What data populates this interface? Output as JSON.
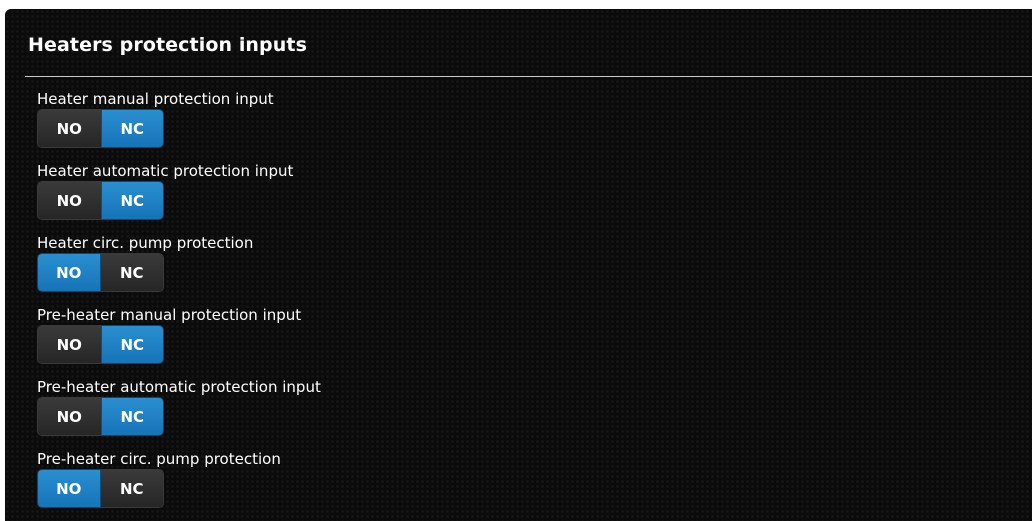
{
  "panel": {
    "title": "Heaters protection inputs"
  },
  "settings": [
    {
      "label": "Heater manual protection input",
      "options": [
        "NO",
        "NC"
      ],
      "selected": "NC"
    },
    {
      "label": "Heater automatic protection input",
      "options": [
        "NO",
        "NC"
      ],
      "selected": "NC"
    },
    {
      "label": "Heater circ. pump protection",
      "options": [
        "NO",
        "NC"
      ],
      "selected": "NO"
    },
    {
      "label": "Pre-heater manual protection input",
      "options": [
        "NO",
        "NC"
      ],
      "selected": "NC"
    },
    {
      "label": "Pre-heater automatic protection input",
      "options": [
        "NO",
        "NC"
      ],
      "selected": "NC"
    },
    {
      "label": "Pre-heater circ. pump protection",
      "options": [
        "NO",
        "NC"
      ],
      "selected": "NO"
    }
  ],
  "colors": {
    "selected": "#1f82c4",
    "unselected": "#303030",
    "background": "#0b0b0b"
  }
}
